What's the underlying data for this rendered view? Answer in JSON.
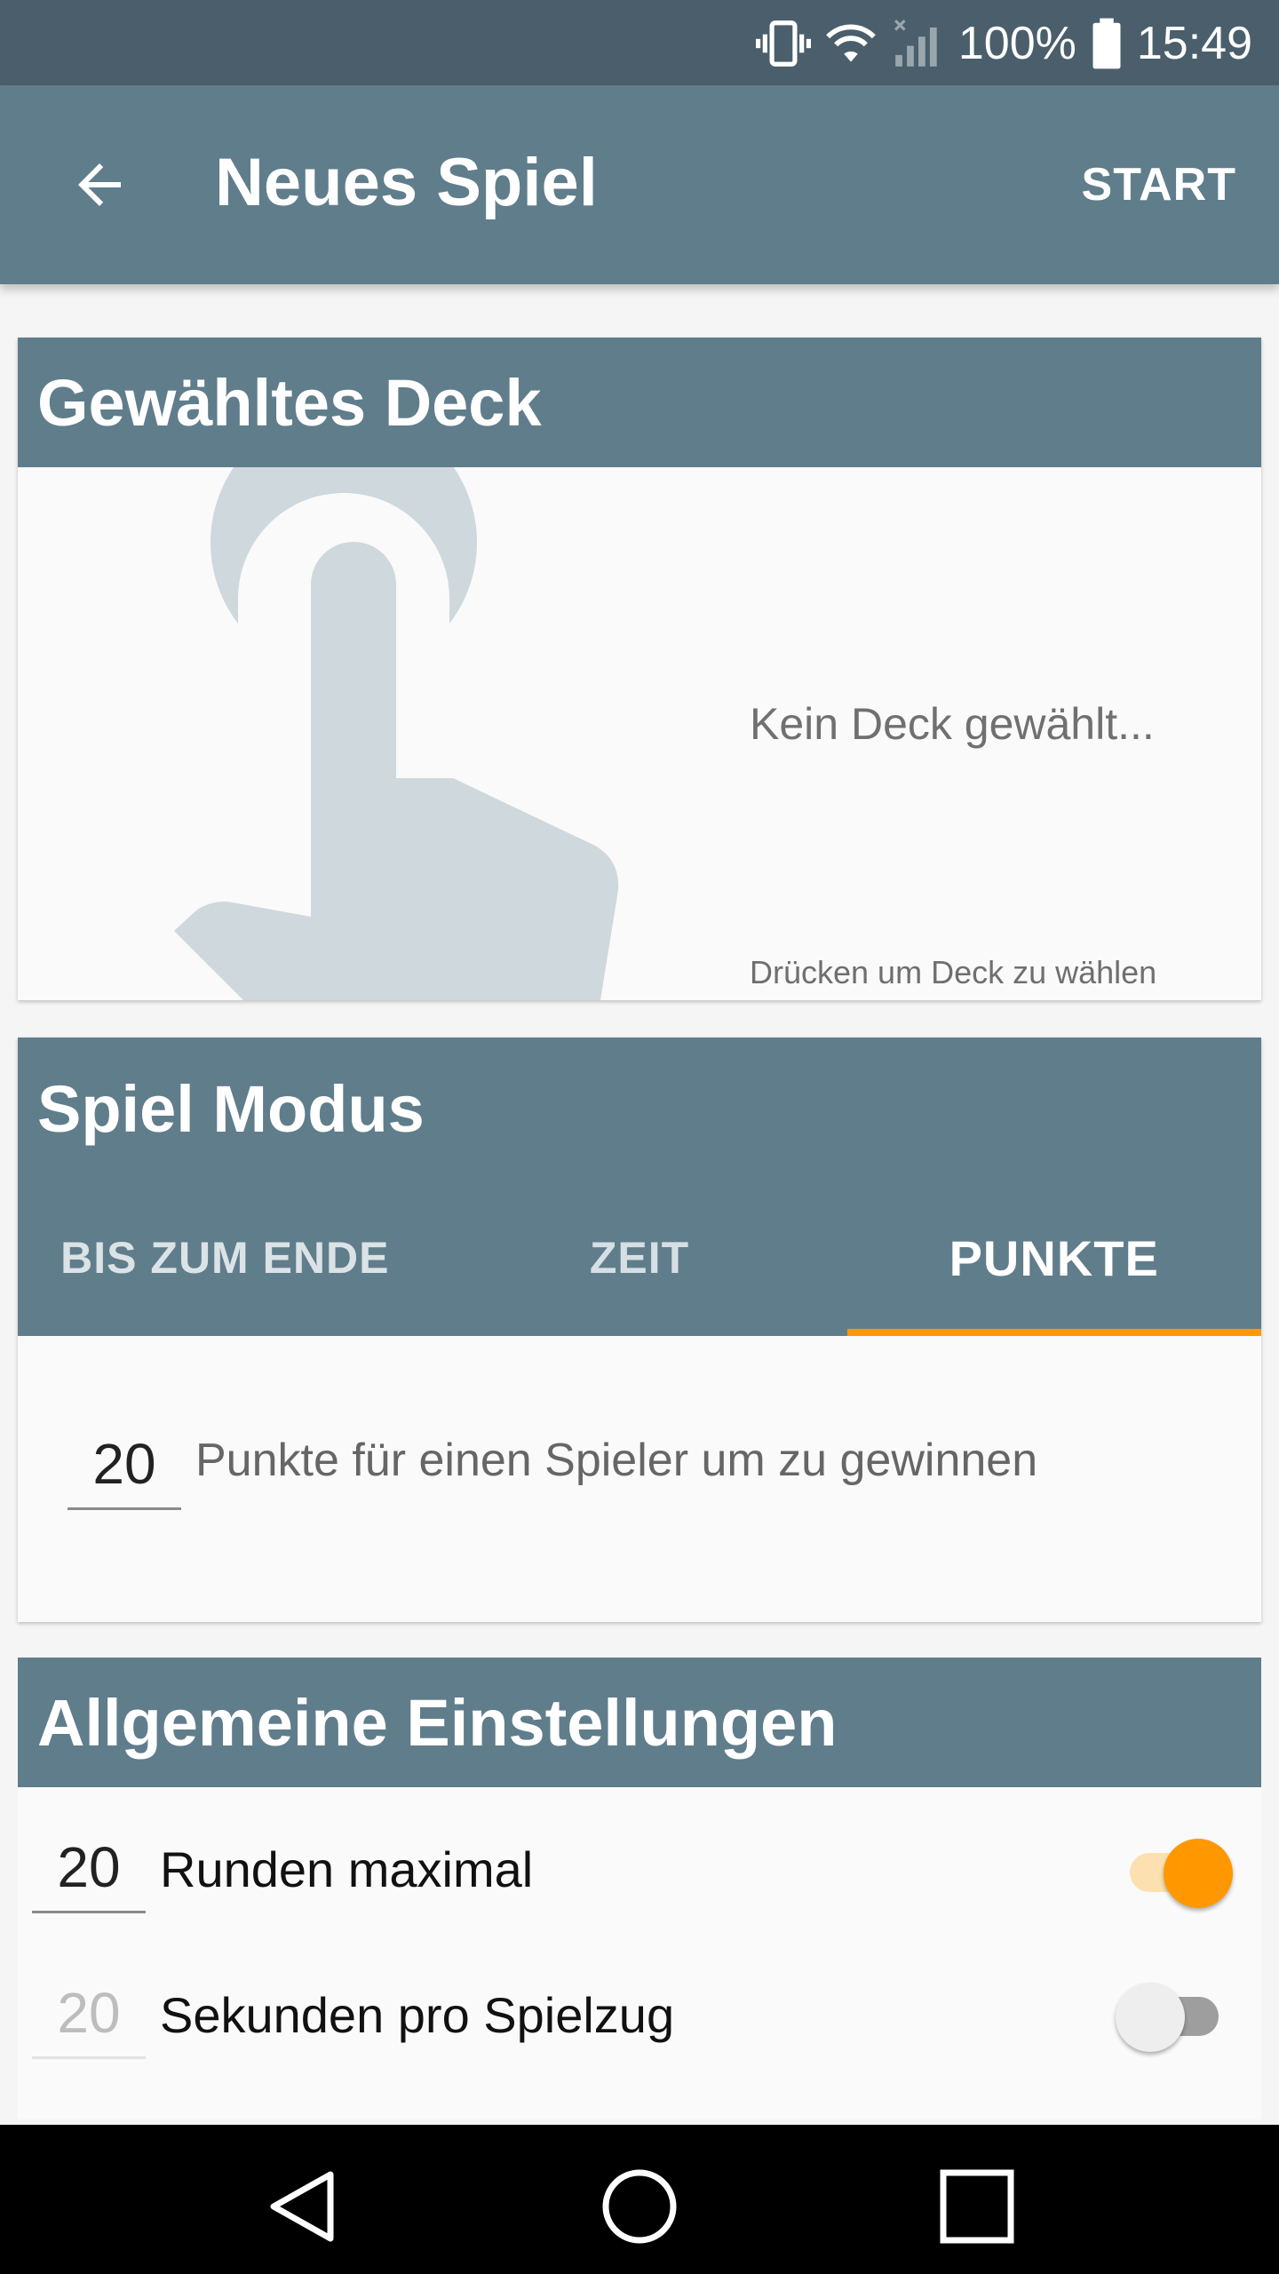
{
  "status_bar": {
    "battery_percent": "100%",
    "time": "15:49",
    "icons": [
      "vibrate-icon",
      "wifi-icon",
      "signal-icon",
      "battery-icon"
    ]
  },
  "app_bar": {
    "title": "Neues Spiel",
    "action": "START",
    "back_icon": "arrow-back-icon"
  },
  "deck_card": {
    "title": "Gewähltes Deck",
    "empty_text": "Kein Deck gewählt...",
    "hint": "Drücken um Deck zu wählen",
    "illustration": "touch-hand-icon"
  },
  "mode_card": {
    "title": "Spiel Modus",
    "tabs": [
      {
        "label": "BIS ZUM ENDE",
        "active": false
      },
      {
        "label": "ZEIT",
        "active": false
      },
      {
        "label": "PUNKTE",
        "active": true
      }
    ],
    "points_value": "20",
    "points_label": "Punkte für einen Spieler um zu gewinnen"
  },
  "general_card": {
    "title": "Allgemeine Einstellungen",
    "settings": [
      {
        "value": "20",
        "label": "Runden maximal",
        "enabled": true
      },
      {
        "value": "20",
        "label": "Sekunden pro Spielzug",
        "enabled": false
      }
    ]
  },
  "nav_bar": {
    "icons": [
      "nav-back-icon",
      "nav-home-icon",
      "nav-recents-icon"
    ]
  },
  "colors": {
    "primary": "#607d8b",
    "status_bar": "#4a5f6b",
    "accent": "#ff9800"
  }
}
